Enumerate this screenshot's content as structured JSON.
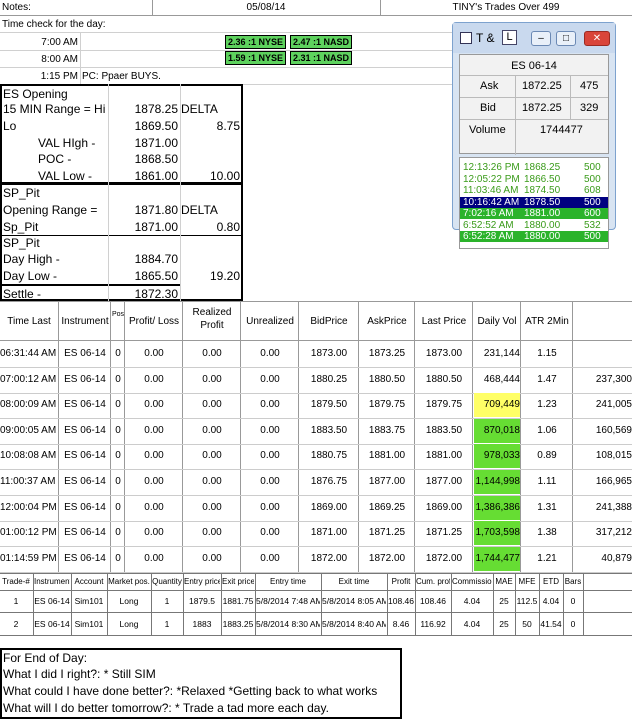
{
  "header": {
    "notes_label": "Notes:",
    "date": "05/08/14",
    "title": "TINY's Trades Over 499"
  },
  "time_check": {
    "label": "Time check for the day:",
    "rows": [
      {
        "time": "7:00 AM",
        "nyse": "2.36 :1 NYSE",
        "nasd": "2.47 :1 NASD"
      },
      {
        "time": "8:00 AM",
        "nyse": "1.59 :1 NYSE",
        "nasd": "2.31 :1 NASD"
      },
      {
        "time": "1:15 PM",
        "note": "PC: Ppaer BUYS."
      }
    ]
  },
  "es_opening": {
    "title": "ES Opening",
    "range_label": "15 MIN Range = Hi",
    "hi": "1878.25",
    "delta_label": "DELTA",
    "lo_label": "Lo",
    "lo": "1869.50",
    "delta": "8.75",
    "val_high_label": "VAL HIgh  -",
    "val_high": "1871.00",
    "poc_label": "POC  -",
    "poc": "1868.50",
    "val_low_label": "VAL Low  -",
    "val_low": "1861.00",
    "val_delta": "10.00"
  },
  "sp_pit": {
    "title": "SP_Pit",
    "opening_range_label": "Opening Range =",
    "opening_range": "1871.80",
    "delta_label": "DELTA",
    "sp_pit_label": "Sp_Pit",
    "sp_pit_value": "1871.00",
    "sp_delta": "0.80",
    "title2": "SP_Pit",
    "day_high_label": "Day High -",
    "day_high": "1884.70",
    "day_low_label": "Day Low -",
    "day_low": "1865.50",
    "day_delta": "19.20",
    "settle_label": "Settle -",
    "settle": "1872.30"
  },
  "tns": {
    "t_label": "T",
    "l_label": "L",
    "instrument": "ES 06-14",
    "ask_label": "Ask",
    "ask": "1872.25",
    "ask_size": "475",
    "bid_label": "Bid",
    "bid": "1872.25",
    "bid_size": "329",
    "volume_label": "Volume",
    "volume": "1744477",
    "trades": [
      {
        "time": "12:13:26 PM",
        "price": "1868.25",
        "size": "500",
        "style": "gt"
      },
      {
        "time": "12:05:22 PM",
        "price": "1866.50",
        "size": "500",
        "style": "gt"
      },
      {
        "time": "11:03:46 AM",
        "price": "1874.50",
        "size": "608",
        "style": "gt"
      },
      {
        "time": "10:16:42 AM",
        "price": "1878.50",
        "size": "500",
        "style": "blue"
      },
      {
        "time": "7:02:16 AM",
        "price": "1881.00",
        "size": "600",
        "style": "greenbg"
      },
      {
        "time": "6:52:52 AM",
        "price": "1880.00",
        "size": "532",
        "style": "gt"
      },
      {
        "time": "6:52:28 AM",
        "price": "1880.00",
        "size": "500",
        "style": "greenbg"
      }
    ]
  },
  "market_table": {
    "headers": [
      "Time Last",
      "Instrument",
      "Pos.",
      "Profit/ Loss",
      "Realized Profit",
      "Unrealized",
      "BidPrice",
      "AskPrice",
      "Last Price",
      "Daily Vol",
      "ATR 2Min"
    ],
    "rows": [
      {
        "time": "06:31:44 AM",
        "inst": "ES 06-14",
        "pos": "0",
        "pl": "0.00",
        "realized": "0.00",
        "unreal": "0.00",
        "bid": "1873.00",
        "ask": "1873.25",
        "last": "1873.00",
        "vol": "231,144",
        "atr": "1.15",
        "extra": "",
        "volbg": ""
      },
      {
        "time": "07:00:12 AM",
        "inst": "ES 06-14",
        "pos": "0",
        "pl": "0.00",
        "realized": "0.00",
        "unreal": "0.00",
        "bid": "1880.25",
        "ask": "1880.50",
        "last": "1880.50",
        "vol": "468,444",
        "atr": "1.47",
        "extra": "237,300",
        "volbg": ""
      },
      {
        "time": "08:00:09 AM",
        "inst": "ES 06-14",
        "pos": "0",
        "pl": "0.00",
        "realized": "0.00",
        "unreal": "0.00",
        "bid": "1879.50",
        "ask": "1879.75",
        "last": "1879.75",
        "vol": "709,449",
        "atr": "1.23",
        "extra": "241,005",
        "volbg": "#ffff66"
      },
      {
        "time": "09:00:05 AM",
        "inst": "ES 06-14",
        "pos": "0",
        "pl": "0.00",
        "realized": "0.00",
        "unreal": "0.00",
        "bid": "1883.50",
        "ask": "1883.75",
        "last": "1883.50",
        "vol": "870,018",
        "atr": "1.06",
        "extra": "160,569",
        "volbg": "#66dd33"
      },
      {
        "time": "10:08:08 AM",
        "inst": "ES 06-14",
        "pos": "0",
        "pl": "0.00",
        "realized": "0.00",
        "unreal": "0.00",
        "bid": "1880.75",
        "ask": "1881.00",
        "last": "1881.00",
        "vol": "978,033",
        "atr": "0.89",
        "extra": "108,015",
        "volbg": "#66dd33"
      },
      {
        "time": "11:00:37 AM",
        "inst": "ES 06-14",
        "pos": "0",
        "pl": "0.00",
        "realized": "0.00",
        "unreal": "0.00",
        "bid": "1876.75",
        "ask": "1877.00",
        "last": "1877.00",
        "vol": "1,144,998",
        "atr": "1.11",
        "extra": "166,965",
        "volbg": "#66dd33"
      },
      {
        "time": "12:00:04 PM",
        "inst": "ES 06-14",
        "pos": "0",
        "pl": "0.00",
        "realized": "0.00",
        "unreal": "0.00",
        "bid": "1869.00",
        "ask": "1869.25",
        "last": "1869.00",
        "vol": "1,386,386",
        "atr": "1.31",
        "extra": "241,388",
        "volbg": "#66dd33"
      },
      {
        "time": "01:00:12 PM",
        "inst": "ES 06-14",
        "pos": "0",
        "pl": "0.00",
        "realized": "0.00",
        "unreal": "0.00",
        "bid": "1871.00",
        "ask": "1871.25",
        "last": "1871.25",
        "vol": "1,703,598",
        "atr": "1.38",
        "extra": "317,212",
        "volbg": "#66dd33"
      },
      {
        "time": "01:14:59 PM",
        "inst": "ES 06-14",
        "pos": "0",
        "pl": "0.00",
        "realized": "0.00",
        "unreal": "0.00",
        "bid": "1872.00",
        "ask": "1872.00",
        "last": "1872.00",
        "vol": "1,744,477",
        "atr": "1.21",
        "extra": "40,879",
        "volbg": "#66dd33"
      }
    ]
  },
  "trade_table": {
    "headers": [
      "Trade-#",
      "Instrument",
      "Account",
      "Market pos.",
      "Quantity",
      "Entry price",
      "Exit price",
      "Entry time",
      "Exit time",
      "Profit",
      "Cum. profit",
      "Commission",
      "MAE",
      "MFE",
      "ETD",
      "Bars"
    ],
    "rows": [
      [
        "1",
        "ES 06-14",
        "Sim101",
        "Long",
        "1",
        "1879.5",
        "1881.75",
        "5/8/2014 7:48 AM",
        "5/8/2014 8:05 AM",
        "108.46",
        "108.46",
        "4.04",
        "25",
        "112.5",
        "4.04",
        "0"
      ],
      [
        "2",
        "ES 06-14",
        "Sim101",
        "Long",
        "1",
        "1883",
        "1883.25",
        "5/8/2014 8:30 AM",
        "5/8/2014 8:40 AM",
        "8.46",
        "116.92",
        "4.04",
        "25",
        "50",
        "41.54",
        "0"
      ]
    ]
  },
  "end_of_day": {
    "title": "For End of Day:",
    "q1": "What I did I right?: * Still SIM",
    "q2": "What could I have done better?: *Relaxed *Getting back to what works",
    "q3": "What will I do better tomorrow?: * Trade a tad more each day."
  },
  "colors": {
    "green": "#5ed25e",
    "bright_green": "#66dd33",
    "yellow": "#ffff66",
    "tns_blue": "#000080",
    "tns_green_text": "#3a9b1a"
  }
}
